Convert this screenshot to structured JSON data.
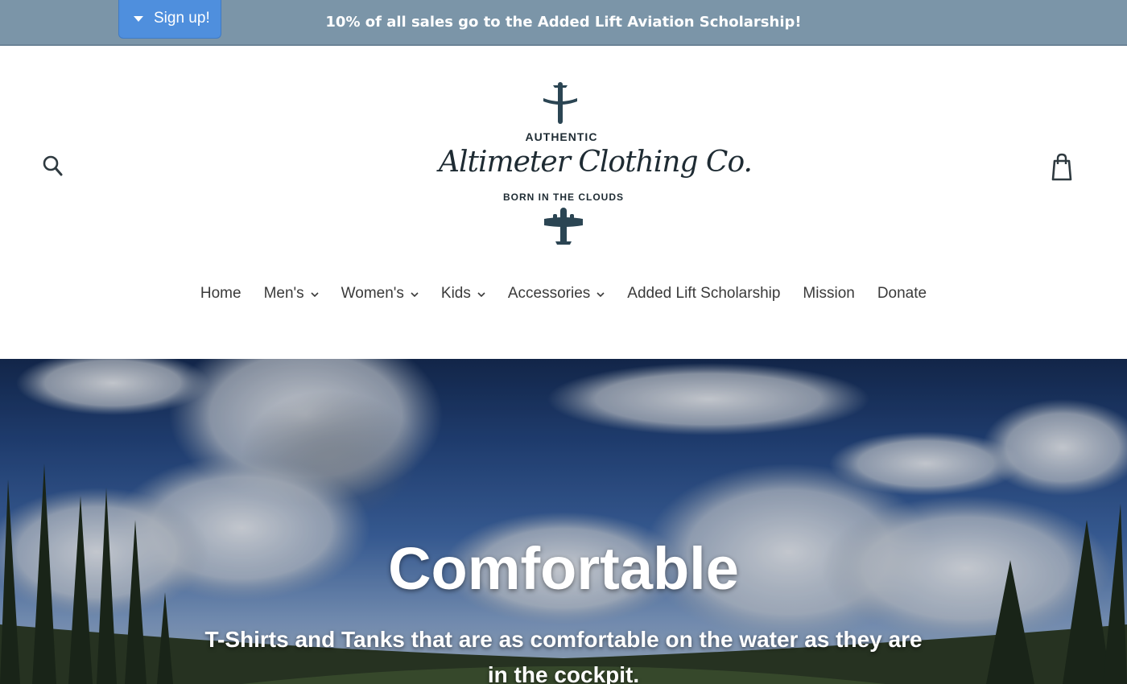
{
  "announcement": {
    "text": "10% of all sales go to the Added Lift Aviation Scholarship!",
    "signup_label": "Sign up!"
  },
  "header": {
    "search_icon": "search-icon",
    "cart_icon": "shopping-bag-icon",
    "logo": {
      "top_text": "AUTHENTIC",
      "brand_script": "Altimeter Clothing Co.",
      "tagline": "BORN IN THE CLOUDS"
    }
  },
  "nav": {
    "items": [
      {
        "label": "Home",
        "dropdown": false
      },
      {
        "label": "Men's",
        "dropdown": true
      },
      {
        "label": "Women's",
        "dropdown": true
      },
      {
        "label": "Kids",
        "dropdown": true
      },
      {
        "label": "Accessories",
        "dropdown": true
      },
      {
        "label": "Added Lift Scholarship",
        "dropdown": false
      },
      {
        "label": "Mission",
        "dropdown": false
      },
      {
        "label": "Donate",
        "dropdown": false
      }
    ]
  },
  "hero": {
    "title": "Comfortable",
    "subtitle": "T-Shirts and Tanks that are as comfortable on the water as they are in the cockpit."
  },
  "colors": {
    "announcement_bg": "#7b95a8",
    "signup_bg": "#4f8fdd",
    "logo_ink": "#1e2b33",
    "nav_text": "#3a3a3a"
  }
}
